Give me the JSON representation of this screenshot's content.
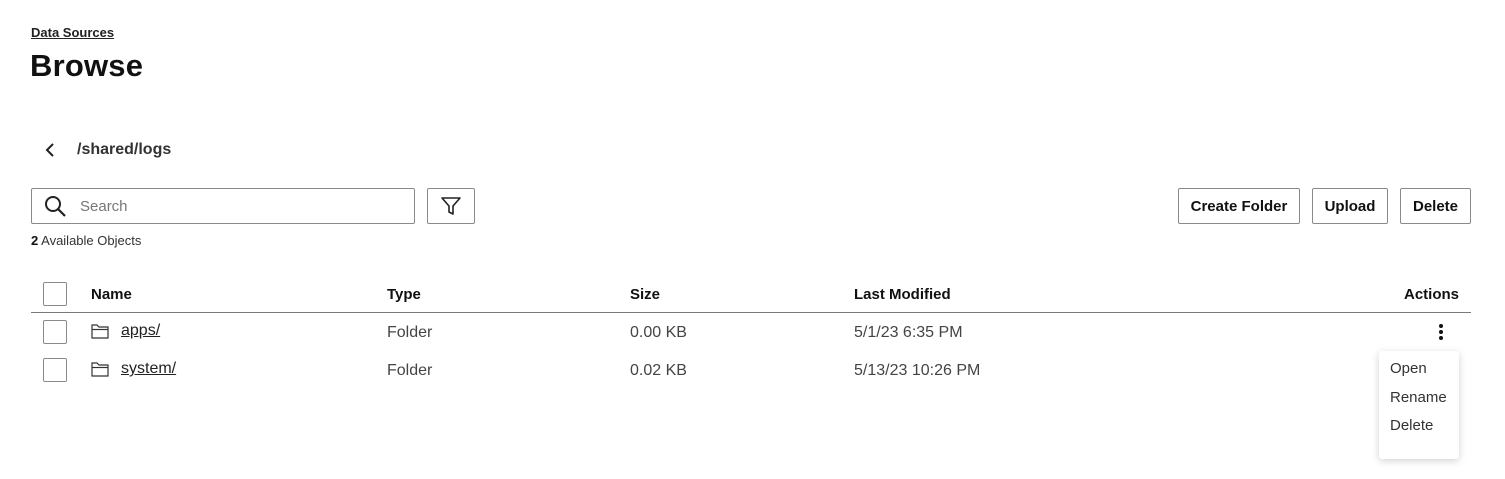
{
  "breadcrumb": {
    "label": "Data Sources"
  },
  "page": {
    "title": "Browse"
  },
  "path": {
    "current": "/shared/logs"
  },
  "search": {
    "placeholder": "Search",
    "value": ""
  },
  "summary": {
    "count": "2",
    "label": " Available Objects"
  },
  "toolbar": {
    "create_folder_label": "Create Folder",
    "upload_label": "Upload",
    "delete_label": "Delete"
  },
  "table": {
    "columns": {
      "name": "Name",
      "type": "Type",
      "size": "Size",
      "modified": "Last Modified",
      "actions": "Actions"
    },
    "rows": [
      {
        "name": "apps/",
        "type": "Folder",
        "size": "0.00 KB",
        "modified": "5/1/23 6:35 PM"
      },
      {
        "name": "system/",
        "type": "Folder",
        "size": "0.02 KB",
        "modified": "5/13/23 10:26 PM"
      }
    ]
  },
  "actions_menu": {
    "items": [
      "Open",
      "Rename",
      "Delete"
    ]
  },
  "icons": {
    "back": "chevron-left-icon",
    "search": "search-icon",
    "filter": "filter-icon",
    "folder": "folder-icon",
    "more": "more-vertical-icon"
  }
}
